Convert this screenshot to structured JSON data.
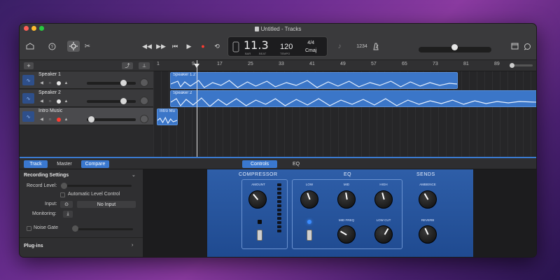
{
  "window": {
    "title": "Untitled - Tracks",
    "traffic_lights": [
      "#ff5f57",
      "#febc2e",
      "#28c840"
    ]
  },
  "toolbar": {
    "icons": [
      "library-icon",
      "help-icon",
      "smart-controls-icon",
      "editors-icon"
    ],
    "transport": [
      "◀◀",
      "▶▶",
      "⏮",
      "▶",
      "●",
      "⟲"
    ],
    "lcd": {
      "bar_beat": "11.3",
      "bar_label": "BAR",
      "beat_label": "BEAT",
      "tempo": "120",
      "tempo_label": "TEMPO",
      "signature_top": "4/4",
      "key": "Cmaj"
    },
    "count_in": "1234",
    "metronome_label": "metronome"
  },
  "tracks": {
    "headers": [
      {
        "name": "Speaker 1"
      },
      {
        "name": "Speaker 2"
      },
      {
        "name": "Intro Music"
      }
    ],
    "ruler": [
      "1",
      "9",
      "17",
      "25",
      "33",
      "41",
      "49",
      "57",
      "65",
      "73",
      "81",
      "89"
    ],
    "regions": [
      {
        "label": "Speaker 1.2"
      },
      {
        "label": "Speaker 2"
      },
      {
        "label": "Intro Mu"
      }
    ]
  },
  "smart_controls": {
    "tabs_left": [
      "Track",
      "Master",
      "Compare"
    ],
    "tabs_center": [
      "Controls",
      "EQ"
    ],
    "inspector": {
      "recording_settings": "Recording Settings",
      "record_level": "Record Level:",
      "auto_level": "Automatic Level Control",
      "input_label": "Input:",
      "input_value": "No Input",
      "monitoring": "Monitoring:",
      "noise_gate": "Noise Gate",
      "plugins": "Plug-ins"
    },
    "compressor": {
      "title": "COMPRESSOR",
      "amount": "AMOUNT"
    },
    "eq": {
      "title": "EQ",
      "low": "LOW",
      "mid": "MID",
      "high": "HIGH",
      "mid_freq": "MID FREQ",
      "low_cut": "LOW CUT"
    },
    "sends": {
      "title": "SENDS",
      "ambience": "AMBIENCE",
      "reverb": "REVERB"
    }
  }
}
